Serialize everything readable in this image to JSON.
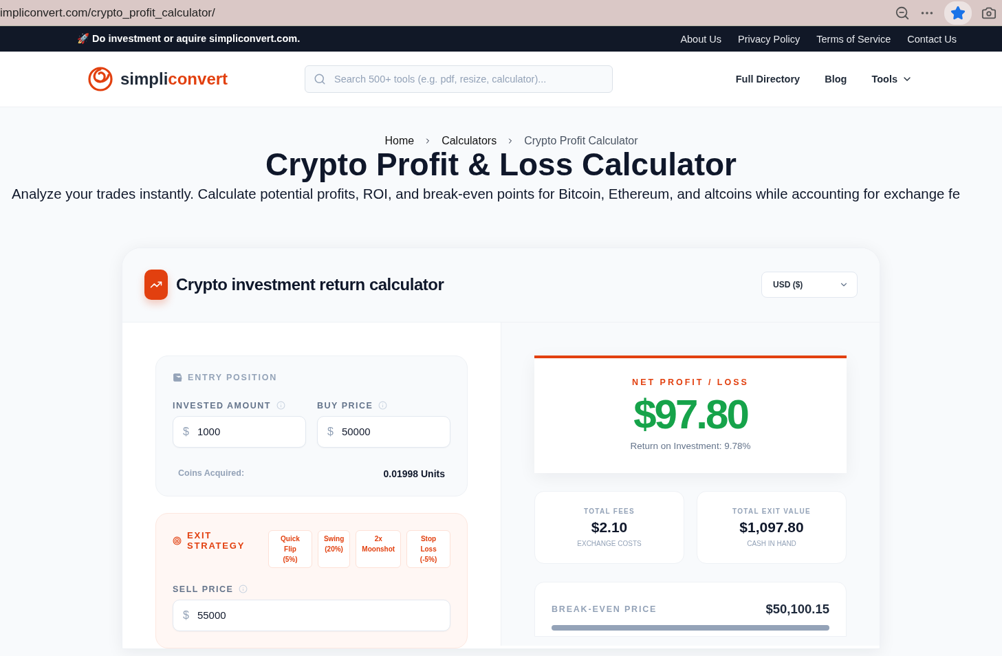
{
  "browser": {
    "url": "impliconvert.com/crypto_profit_calculator/",
    "bookmarked": true
  },
  "announcement": {
    "icon": "🚀",
    "text": "Do investment or aquire simpliconvert.com."
  },
  "top_links": [
    "About Us",
    "Privacy Policy",
    "Terms of Service",
    "Contact Us"
  ],
  "header": {
    "logo_main": "simpli",
    "logo_accent": "convert",
    "search": {
      "placeholder": "Search 500+ tools (e.g. pdf, resize, calculator)..."
    },
    "nav": [
      {
        "label": "Full Directory",
        "dropdown": false
      },
      {
        "label": "Blog",
        "dropdown": false
      },
      {
        "label": "Tools",
        "dropdown": true
      }
    ]
  },
  "breadcrumb": [
    {
      "label": "Home",
      "current": false
    },
    {
      "label": "Calculators",
      "current": false
    },
    {
      "label": "Crypto Profit Calculator",
      "current": true
    }
  ],
  "title": "Crypto Profit & Loss Calculator",
  "subtitle": "Analyze your trades instantly. Calculate potential profits, ROI, and break-even points for Bitcoin, Ethereum, and altcoins while accounting for exchange fe",
  "calculator": {
    "title": "Crypto investment return calculator",
    "currency": "USD ($)",
    "entry": {
      "heading": "ENTRY POSITION",
      "fields": [
        {
          "label": "INVESTED AMOUNT",
          "prefix": "$",
          "value": "1000"
        },
        {
          "label": "BUY PRICE",
          "prefix": "$",
          "value": "50000"
        }
      ],
      "coins_label": "Coins Acquired:",
      "coins_value": "0.01998 Units"
    },
    "exit": {
      "heading": "EXIT STRATEGY",
      "presets": [
        {
          "line1": "Quick Flip",
          "line2": "(5%)"
        },
        {
          "line1": "Swing",
          "line2": "(20%)"
        },
        {
          "line1": "2x",
          "line2": "Moonshot"
        },
        {
          "line1": "Stop Loss",
          "line2": "(-5%)"
        }
      ],
      "sell": {
        "label": "SELL PRICE",
        "prefix": "$",
        "value": "55000"
      }
    },
    "result": {
      "label": "NET PROFIT / LOSS",
      "value": "$97.80",
      "positive": true,
      "roi": "Return on Investment: 9.78%"
    },
    "stats": [
      {
        "label": "TOTAL FEES",
        "value": "$2.10",
        "note": "EXCHANGE COSTS"
      },
      {
        "label": "TOTAL EXIT VALUE",
        "value": "$1,097.80",
        "note": "CASH IN HAND"
      }
    ],
    "breakeven": {
      "label": "BREAK-EVEN PRICE",
      "value": "$50,100.15"
    }
  }
}
